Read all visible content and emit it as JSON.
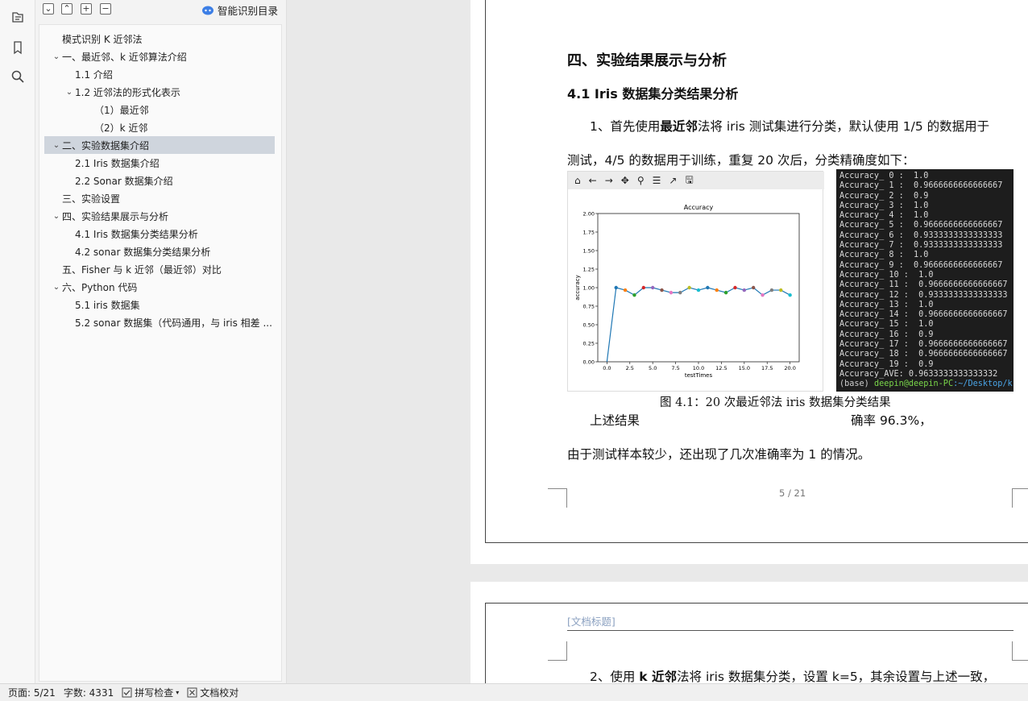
{
  "rail": {
    "icons": [
      "outline-icon",
      "bookmark-icon",
      "search-icon"
    ]
  },
  "panel": {
    "toolbar": [
      "⌄",
      "⌃",
      "+",
      "−"
    ],
    "smart_label": "智能识别目录",
    "tree": [
      {
        "label": "模式识别  K 近邻法",
        "level": 0,
        "chevron": ""
      },
      {
        "label": "一、最近邻、k 近邻算法介绍",
        "level": 0,
        "chevron": "⌄"
      },
      {
        "label": "1.1  介绍",
        "level": 1,
        "chevron": ""
      },
      {
        "label": "1.2  近邻法的形式化表示",
        "level": 1,
        "chevron": "⌄"
      },
      {
        "label": "（1）最近邻",
        "level": 2,
        "chevron": ""
      },
      {
        "label": "（2）k 近邻",
        "level": 2,
        "chevron": ""
      },
      {
        "label": "二、实验数据集介绍",
        "level": 0,
        "chevron": "⌄",
        "selected": true
      },
      {
        "label": "2.1 Iris 数据集介绍",
        "level": 1,
        "chevron": ""
      },
      {
        "label": "2.2 Sonar 数据集介绍",
        "level": 1,
        "chevron": ""
      },
      {
        "label": "三、实验设置",
        "level": 0,
        "chevron": ""
      },
      {
        "label": "四、实验结果展示与分析",
        "level": 0,
        "chevron": "⌄"
      },
      {
        "label": "4.1 Iris 数据集分类结果分析",
        "level": 1,
        "chevron": ""
      },
      {
        "label": "4.2 sonar 数据集分类结果分析",
        "level": 1,
        "chevron": ""
      },
      {
        "label": "五、Fisher 与 k 近邻（最近邻）对比",
        "level": 0,
        "chevron": ""
      },
      {
        "label": "六、Python 代码",
        "level": 0,
        "chevron": "⌄"
      },
      {
        "label": "5.1 iris 数据集",
        "level": 1,
        "chevron": ""
      },
      {
        "label": "5.2 sonar 数据集（代码通用，与 iris 相差 ...",
        "level": 1,
        "chevron": ""
      }
    ]
  },
  "doc": {
    "section_title": "四、实验结果展示与分析",
    "subsection_title": "4.1 Iris 数据集分类结果分析",
    "p1_pre": "1、首先使用",
    "p1_bold": "最近邻",
    "p1_post": "法将 iris 测试集进行分类，默认使用 1/5 的数据用于",
    "p2": "测试，4/5 的数据用于训练，重复 20 次后，分类精确度如下：",
    "caption": "图 4.1：20 次最近邻法 iris 数据集分类结果",
    "p3_a": "上述结果",
    "p3_b": "确率 96.3%，",
    "p4": "由于测试样本较少，还出现了几次准确率为 1 的情况。",
    "page_number": "5 / 21",
    "header_placeholder": "[文档标题]",
    "p5_pre": "2、使用 ",
    "p5_bold": "k 近邻",
    "p5_post": "法将 iris 数据集分类，设置 k=5，其余设置与上述一致，"
  },
  "plot_toolbar": [
    "⌂",
    "←",
    "→",
    "✥",
    "⚲",
    "☰",
    "↗",
    "🖫"
  ],
  "terminal": {
    "lines": [
      "Accuracy_ 0 :  1.0",
      "Accuracy_ 1 :  0.9666666666666667",
      "Accuracy_ 2 :  0.9",
      "Accuracy_ 3 :  1.0",
      "Accuracy_ 4 :  1.0",
      "Accuracy_ 5 :  0.9666666666666667",
      "Accuracy_ 6 :  0.9333333333333333",
      "Accuracy_ 7 :  0.9333333333333333",
      "Accuracy_ 8 :  1.0",
      "Accuracy_ 9 :  0.9666666666666667",
      "Accuracy_ 10 :  1.0",
      "Accuracy_ 11 :  0.9666666666666667",
      "Accuracy_ 12 :  0.9333333333333333",
      "Accuracy_ 13 :  1.0",
      "Accuracy_ 14 :  0.9666666666666667",
      "Accuracy_ 15 :  1.0",
      "Accuracy_ 16 :  0.9",
      "Accuracy_ 17 :  0.9666666666666667",
      "Accuracy_ 18 :  0.9666666666666667",
      "Accuracy_ 19 :  0.9",
      "Accuracy_AVE: 0.9633333333333332"
    ],
    "prompt_base": "(base) ",
    "prompt_user": "deepin@deepin-PC",
    "prompt_path": ":~/Desktop/k"
  },
  "chart_data": {
    "type": "line",
    "title": "Accuracy",
    "xlabel": "testTimes",
    "ylabel": "accuracy",
    "xlim": [
      -1,
      21
    ],
    "ylim": [
      0,
      2.0
    ],
    "xticks": [
      "0.0",
      "2.5",
      "5.0",
      "7.5",
      "10.0",
      "12.5",
      "15.0",
      "17.5",
      "20.0"
    ],
    "yticks": [
      "0.00",
      "0.25",
      "0.50",
      "0.75",
      "1.00",
      "1.25",
      "1.50",
      "1.75",
      "2.00"
    ],
    "x": [
      0,
      1,
      2,
      3,
      4,
      5,
      6,
      7,
      8,
      9,
      10,
      11,
      12,
      13,
      14,
      15,
      16,
      17,
      18,
      19,
      20
    ],
    "y": [
      0,
      1.0,
      0.9667,
      0.9,
      1.0,
      1.0,
      0.9667,
      0.9333,
      0.9333,
      1.0,
      0.9667,
      1.0,
      0.9667,
      0.9333,
      1.0,
      0.9667,
      1.0,
      0.9,
      0.9667,
      0.9667,
      0.9
    ],
    "marker_colors": [
      "#1f77b4",
      "#ff7f0e",
      "#2ca02c",
      "#d62728",
      "#9467bd",
      "#8c564b",
      "#e377c2",
      "#7f7f7f",
      "#bcbd22",
      "#17becf"
    ],
    "line_color": "#1f77b4"
  },
  "status": {
    "page": "页面: 5/21",
    "words": "字数: 4331",
    "spell": "拼写检查",
    "proof": "文档校对"
  }
}
